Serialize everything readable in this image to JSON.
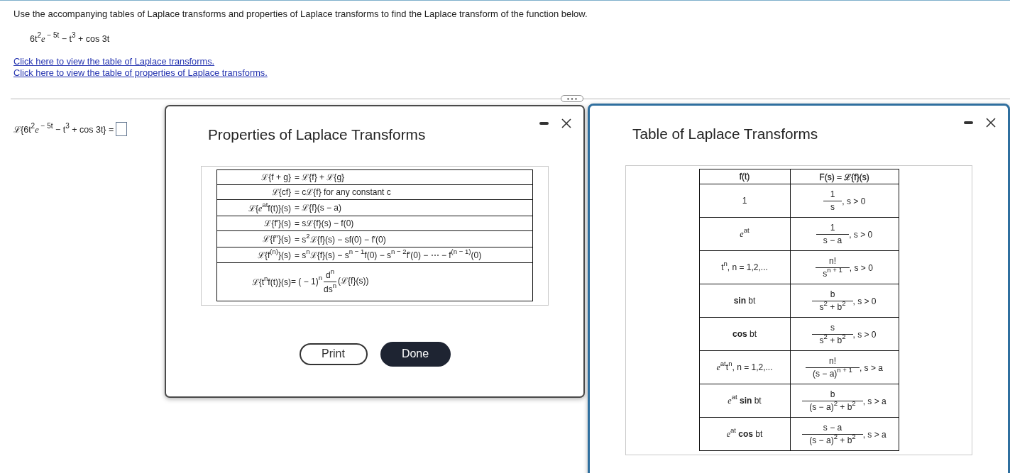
{
  "question": {
    "instruction": "Use the accompanying tables of Laplace transforms and properties of Laplace transforms to find the Laplace transform of the function below.",
    "function": "6t$^{2}$*e*$^{ − 5t}$ − t$^{3}$ + cos 3t",
    "links": [
      "Click here to view the table of Laplace transforms.",
      "Click here to view the table of properties of Laplace transforms."
    ]
  },
  "answer": {
    "expression": "ℒ{6t$^{2}$*e*$^{ − 5t}$ − t$^{3}$ + cos 3t} ="
  },
  "dialogs": [
    {
      "kind": "properties",
      "title": "Properties of Laplace Transforms",
      "focused": false,
      "rows": [
        {
          "lhs": "ℒ{f + g}",
          "rhs": [
            {
              "kind": "text",
              "text": "= ℒ{f} + ℒ{g}"
            }
          ]
        },
        {
          "lhs": "ℒ{cf}",
          "rhs": [
            {
              "kind": "text",
              "text": "= cℒ{f} for any constant c"
            }
          ]
        },
        {
          "lhs": "ℒ{*e*$^{at}$f(t)}(s)",
          "rhs": [
            {
              "kind": "text",
              "text": "= ℒ{f}(s − a)"
            }
          ]
        },
        {
          "lhs": "ℒ{f′}(s)",
          "rhs": [
            {
              "kind": "text",
              "text": "= sℒ{f}(s) − f(0)"
            }
          ]
        },
        {
          "lhs": "ℒ{f′′}(s)",
          "rhs": [
            {
              "kind": "text",
              "text": "= s$^{2}$ℒ{f}(s) − sf(0) − f′(0)"
            }
          ]
        },
        {
          "lhs": "ℒ{f$^{(n)}$}(s)",
          "rhs": [
            {
              "kind": "text",
              "text": "= s$^{n}$ℒ{f}(s) − s$^{n − 1}$f(0) − s$^{n − 2}$f′(0) − ⋯ − f$^{(n − 1)}$(0)"
            }
          ]
        },
        {
          "lhs": "ℒ{t$^{n}$f(t)}(s)",
          "rhs": [
            {
              "kind": "text",
              "text": "= ( − 1)$^{n}$"
            },
            {
              "kind": "fraction",
              "numerator": "d$^{n}$",
              "denominator": "ds$^{n}$"
            },
            {
              "kind": "text",
              "text": "(ℒ{f}(s))"
            }
          ]
        }
      ],
      "buttons": [
        {
          "label": "Print",
          "kind": "secondary"
        },
        {
          "label": "Done",
          "kind": "primary"
        }
      ]
    },
    {
      "kind": "transforms",
      "title": "Table of Laplace Transforms",
      "focused": true,
      "columns": [
        "f(t)",
        "F(s) = ℒ{f}(s)"
      ],
      "rows": [
        {
          "function": "1",
          "transform": {
            "numerator": "1",
            "denominator": "s",
            "condition": ", s > 0"
          }
        },
        {
          "function": "*e*$^{at}$",
          "transform": {
            "numerator": "1",
            "denominator": "s − a",
            "condition": ", s > 0"
          }
        },
        {
          "function": "t$^{n}$, n = 1,2,...",
          "transform": {
            "numerator": "n!",
            "denominator": "s$^{n + 1}$",
            "condition": ", s > 0"
          }
        },
        {
          "function": "**sin** bt",
          "transform": {
            "numerator": "b",
            "denominator": "s$^{2}$ + b$^{2}$",
            "condition": ", s > 0"
          }
        },
        {
          "function": "**cos** bt",
          "transform": {
            "numerator": "s",
            "denominator": "s$^{2}$ + b$^{2}$",
            "condition": ", s > 0"
          }
        },
        {
          "function": "*e*$^{at}$t$^{n}$, n = 1,2,...",
          "transform": {
            "numerator": "n!",
            "denominator": "(s − a)$^{n + 1}$",
            "condition": ", s > a"
          }
        },
        {
          "function": "*e*$^{at}$ **sin** bt",
          "transform": {
            "numerator": "b",
            "denominator": "(s − a)$^{2}$ + b$^{2}$",
            "condition": ", s > a"
          }
        },
        {
          "function": "*e*$^{at}$ **cos** bt",
          "transform": {
            "numerator": "s − a",
            "denominator": "(s − a)$^{2}$ + b$^{2}$",
            "condition": ", s > a"
          }
        }
      ]
    }
  ]
}
